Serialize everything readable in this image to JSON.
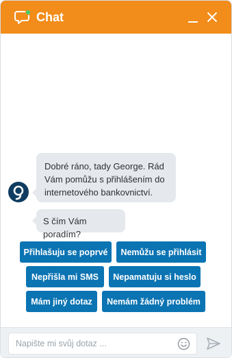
{
  "header": {
    "title": "Chat",
    "icon": "chat-bubble-icon",
    "minimize_icon": "minimize-icon",
    "close_icon": "close-icon",
    "color": "#f28c1a"
  },
  "messages": [
    {
      "text": "Dobré ráno, tady George. Rád Vám pomůžu s přihlášením do internetového bankovnictví."
    },
    {
      "text": "S čím Vám poradím?"
    }
  ],
  "avatar": {
    "icon": "george-logo-icon",
    "color": "#0f3c61"
  },
  "quick_replies": [
    {
      "label": "Přihlašuju se poprvé"
    },
    {
      "label": "Nemůžu se přihlásit"
    },
    {
      "label": "Nepřišla mi SMS"
    },
    {
      "label": "Nepamatuju si heslo"
    },
    {
      "label": "Mám jiný dotaz"
    },
    {
      "label": "Nemám žádný problém"
    }
  ],
  "quick_reply_color": "#0b74b3",
  "input": {
    "placeholder": "Napište mi svůj dotaz ...",
    "value": ""
  },
  "footer": {
    "emoji_icon": "smiley-icon",
    "send_icon": "send-icon"
  }
}
